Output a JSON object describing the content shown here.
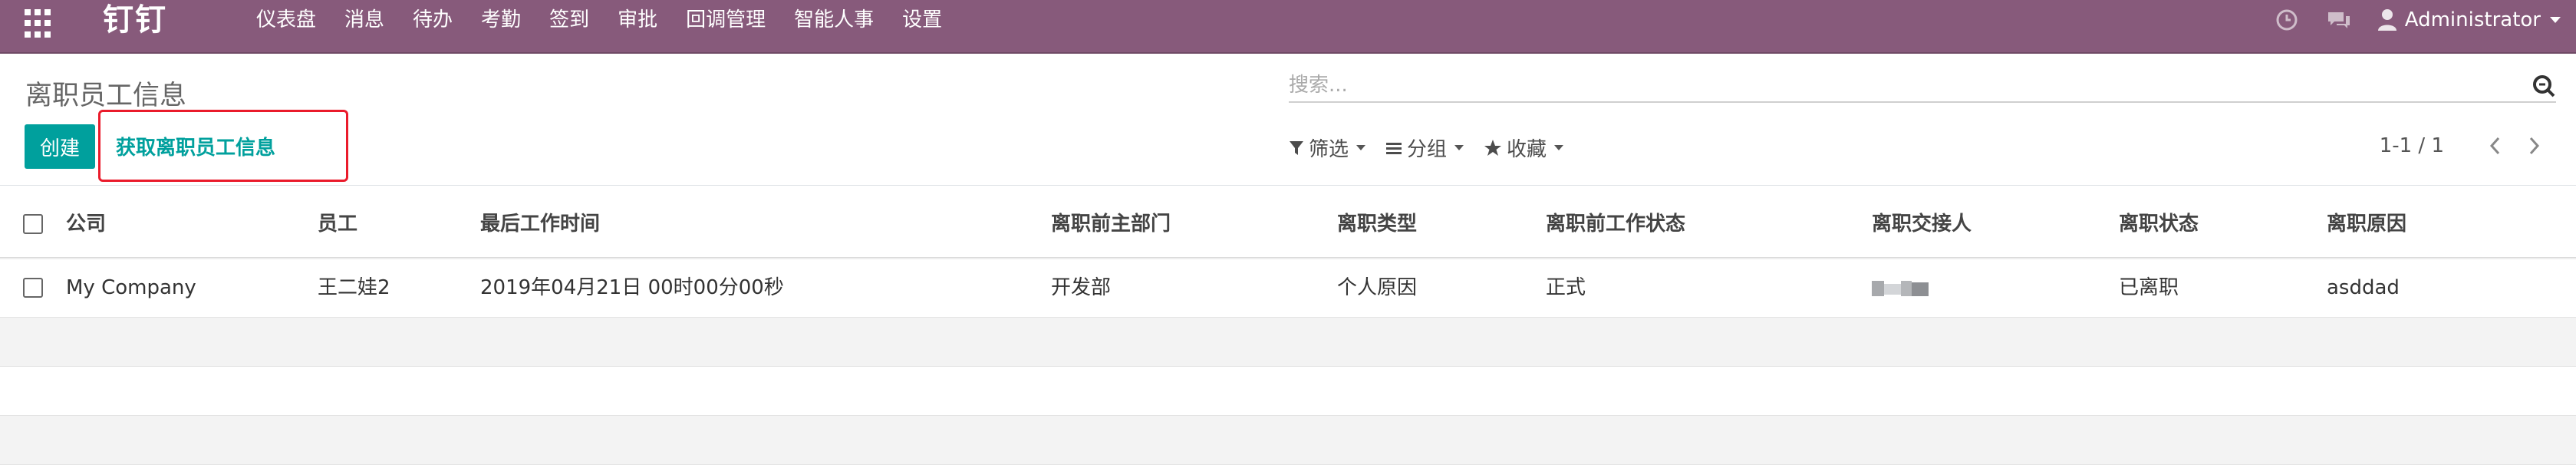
{
  "navbar": {
    "brand": "钉钉",
    "menu": [
      "仪表盘",
      "消息",
      "待办",
      "考勤",
      "签到",
      "审批",
      "回调管理",
      "智能人事",
      "设置"
    ],
    "user": "Administrator",
    "icons": [
      "apps-icon",
      "clock-icon",
      "chat-icon",
      "user-icon"
    ]
  },
  "breadcrumb": "离职员工信息",
  "buttons": {
    "create": "创建",
    "fetch": "获取离职员工信息"
  },
  "search": {
    "placeholder": "搜索..."
  },
  "filters": {
    "filter": "筛选",
    "group": "分组",
    "favorites": "收藏"
  },
  "pager": {
    "value": "1-1 / 1"
  },
  "table": {
    "headers": [
      "公司",
      "员工",
      "最后工作时间",
      "离职前主部门",
      "离职类型",
      "离职前工作状态",
      "离职交接人",
      "离职状态",
      "离职原因"
    ],
    "rows": [
      {
        "company": "My Company",
        "employee": "王二娃2",
        "last_work_time": "2019年04月21日 00时00分00秒",
        "department": "开发部",
        "leave_type": "个人原因",
        "work_status": "正式",
        "handover": "",
        "leave_status": "已离职",
        "reason": "asddad"
      }
    ]
  },
  "colors": {
    "navbar": "#875a7b",
    "primary": "#00a09d",
    "highlight": "#ea1b2b"
  }
}
